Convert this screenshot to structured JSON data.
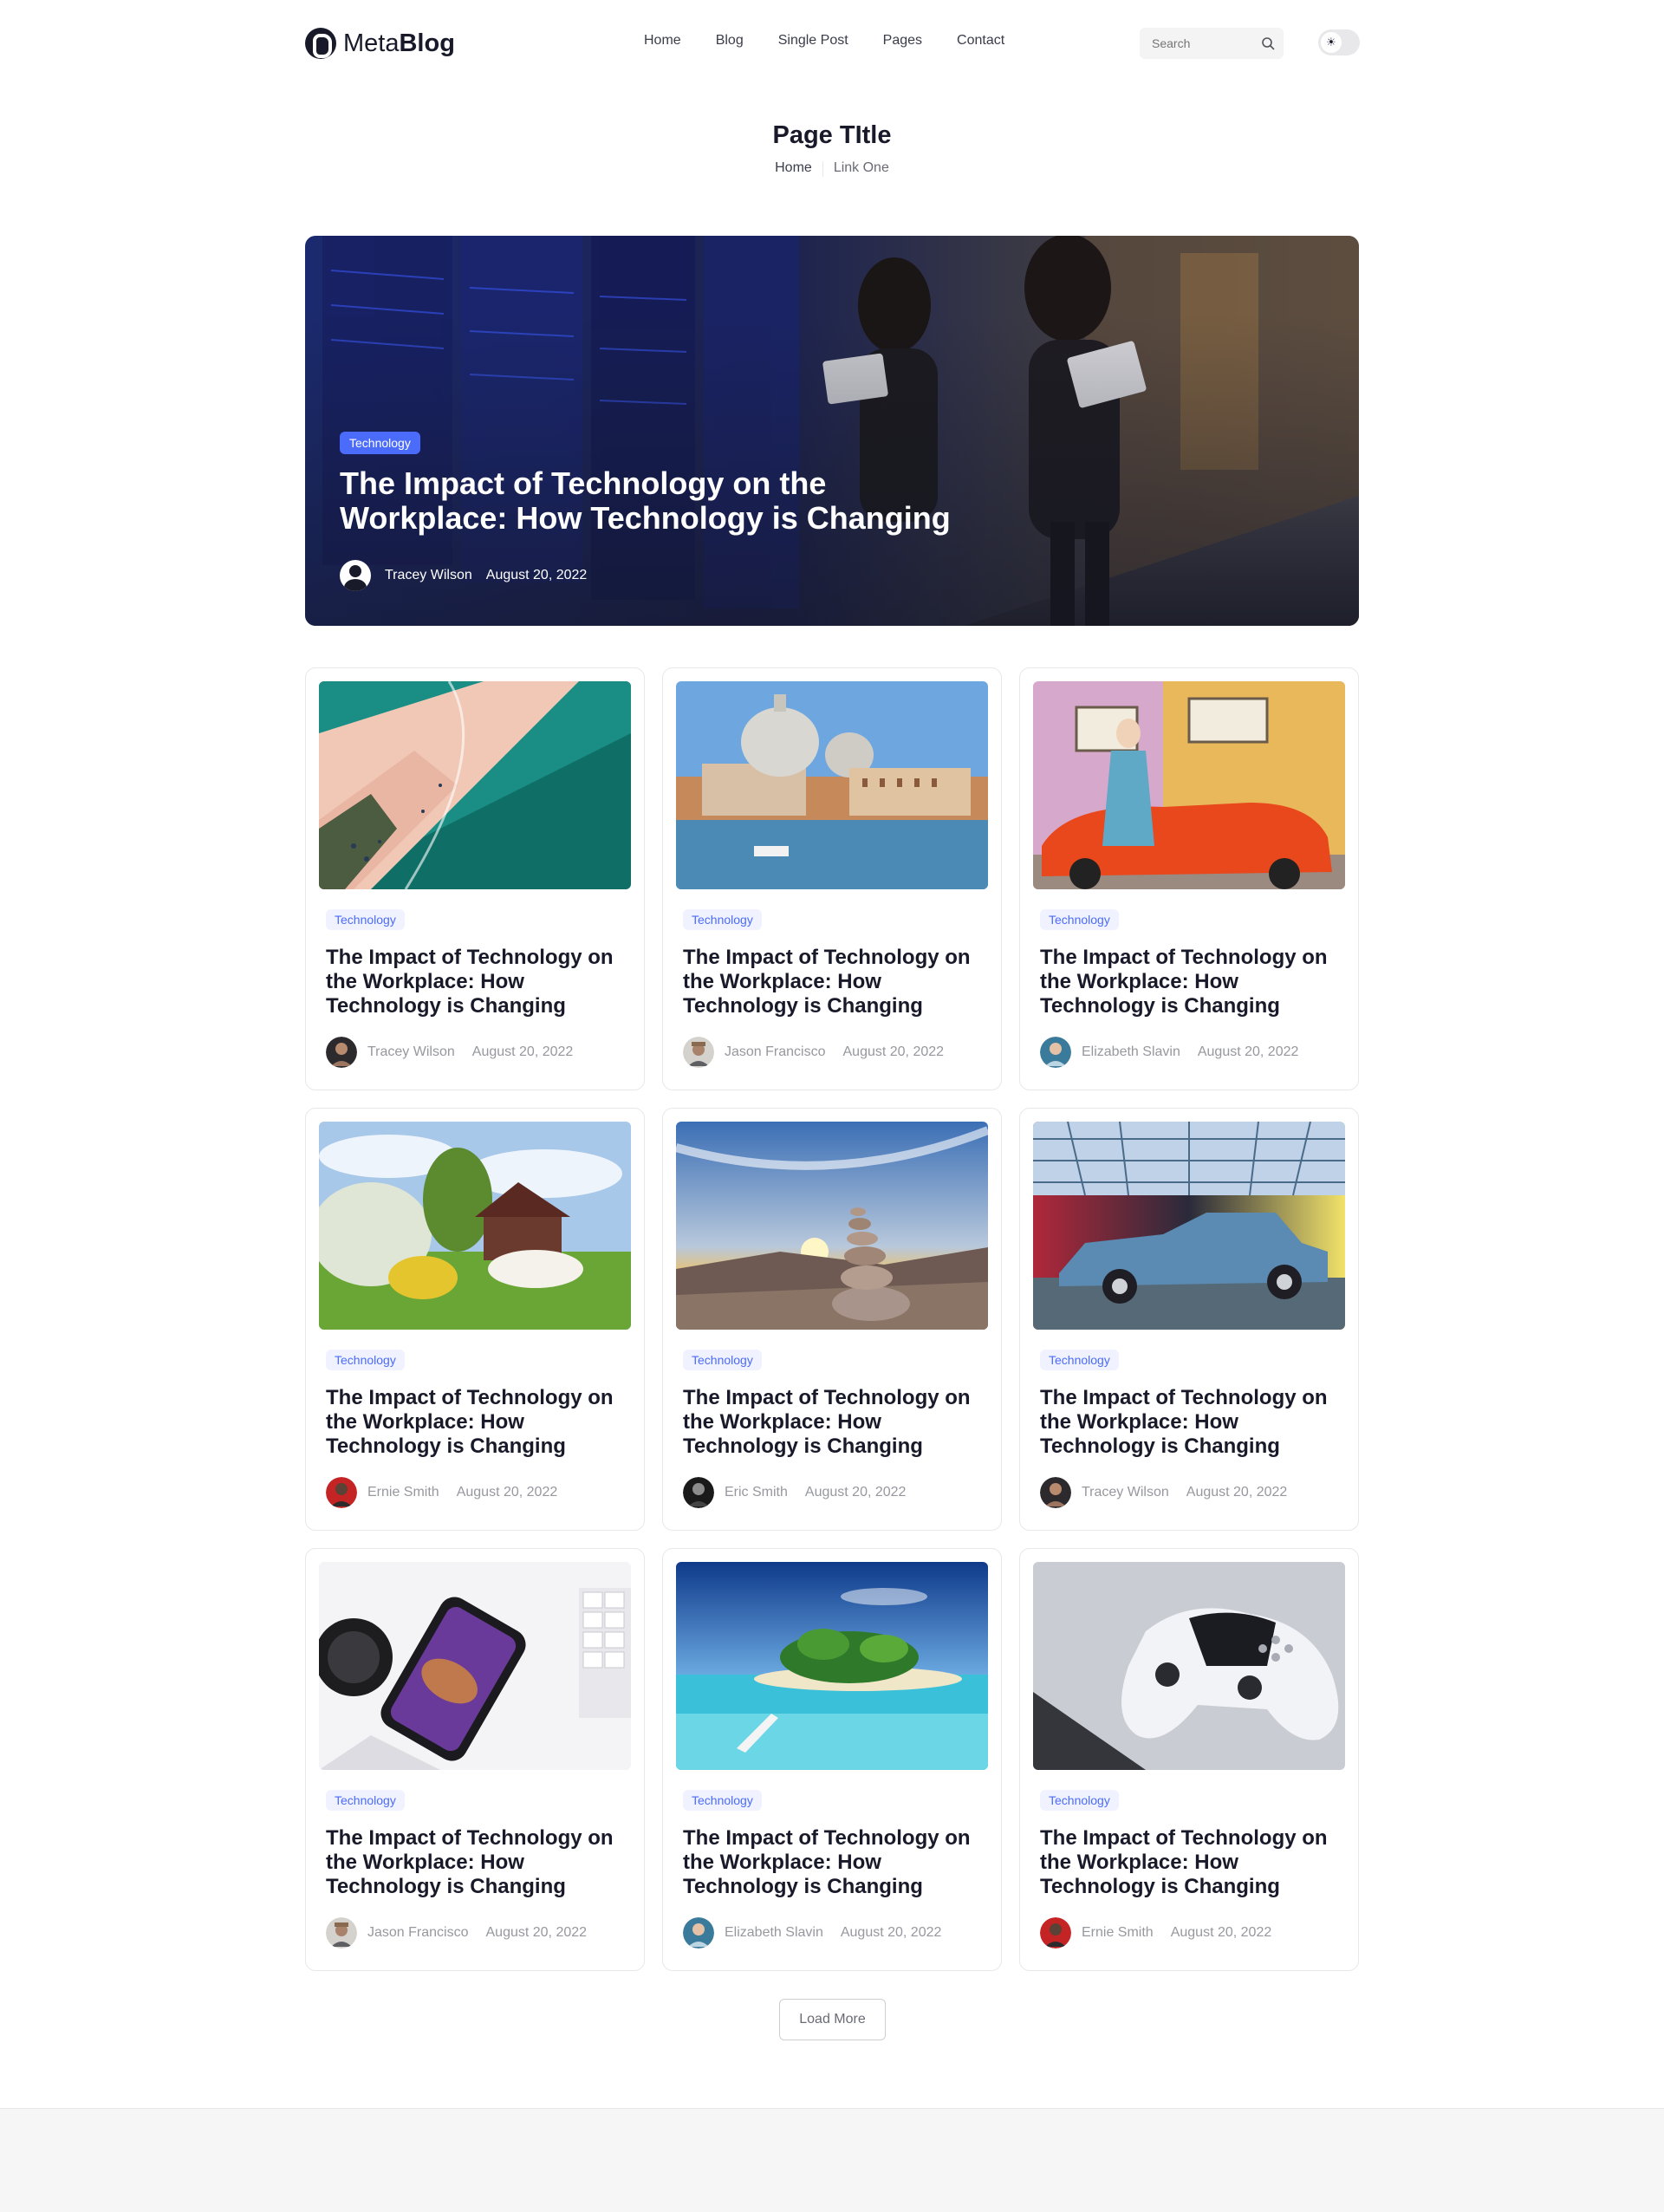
{
  "brand": {
    "name_light": "Meta",
    "name_bold": "Blog"
  },
  "nav": [
    "Home",
    "Blog",
    "Single Post",
    "Pages",
    "Contact"
  ],
  "search": {
    "placeholder": "Search"
  },
  "theme_toggle": {
    "icon": "sun-icon"
  },
  "page": {
    "title": "Page TItle",
    "breadcrumb": [
      "Home",
      "Link One"
    ]
  },
  "hero": {
    "category": "Technology",
    "title": "The Impact of Technology on the Workplace: How Technology is Changing",
    "author": "Tracey Wilson",
    "date": "August 20, 2022"
  },
  "posts": [
    {
      "category": "Technology",
      "title": "The Impact of Technology on the Workplace: How Technology is Changing",
      "author": "Tracey Wilson",
      "date": "August 20, 2022"
    },
    {
      "category": "Technology",
      "title": "The Impact of Technology on the Workplace: How Technology is Changing",
      "author": "Jason Francisco",
      "date": "August 20, 2022"
    },
    {
      "category": "Technology",
      "title": "The Impact of Technology on the Workplace: How Technology is Changing",
      "author": "Elizabeth Slavin",
      "date": "August 20, 2022"
    },
    {
      "category": "Technology",
      "title": "The Impact of Technology on the Workplace: How Technology is Changing",
      "author": "Ernie Smith",
      "date": "August 20, 2022"
    },
    {
      "category": "Technology",
      "title": "The Impact of Technology on the Workplace: How Technology is Changing",
      "author": "Eric Smith",
      "date": "August 20, 2022"
    },
    {
      "category": "Technology",
      "title": "The Impact of Technology on the Workplace: How Technology is Changing",
      "author": "Tracey Wilson",
      "date": "August 20, 2022"
    },
    {
      "category": "Technology",
      "title": "The Impact of Technology on the Workplace: How Technology is Changing",
      "author": "Jason Francisco",
      "date": "August 20, 2022"
    },
    {
      "category": "Technology",
      "title": "The Impact of Technology on the Workplace: How Technology is Changing",
      "author": "Elizabeth Slavin",
      "date": "August 20, 2022"
    },
    {
      "category": "Technology",
      "title": "The Impact of Technology on the Workplace: How Technology is Changing",
      "author": "Ernie Smith",
      "date": "August 20, 2022"
    }
  ],
  "load_more": "Load More",
  "colors": {
    "accent": "#4b6bfb",
    "text": "#181a2a",
    "muted": "#97989f",
    "border": "#e8e8ea"
  }
}
